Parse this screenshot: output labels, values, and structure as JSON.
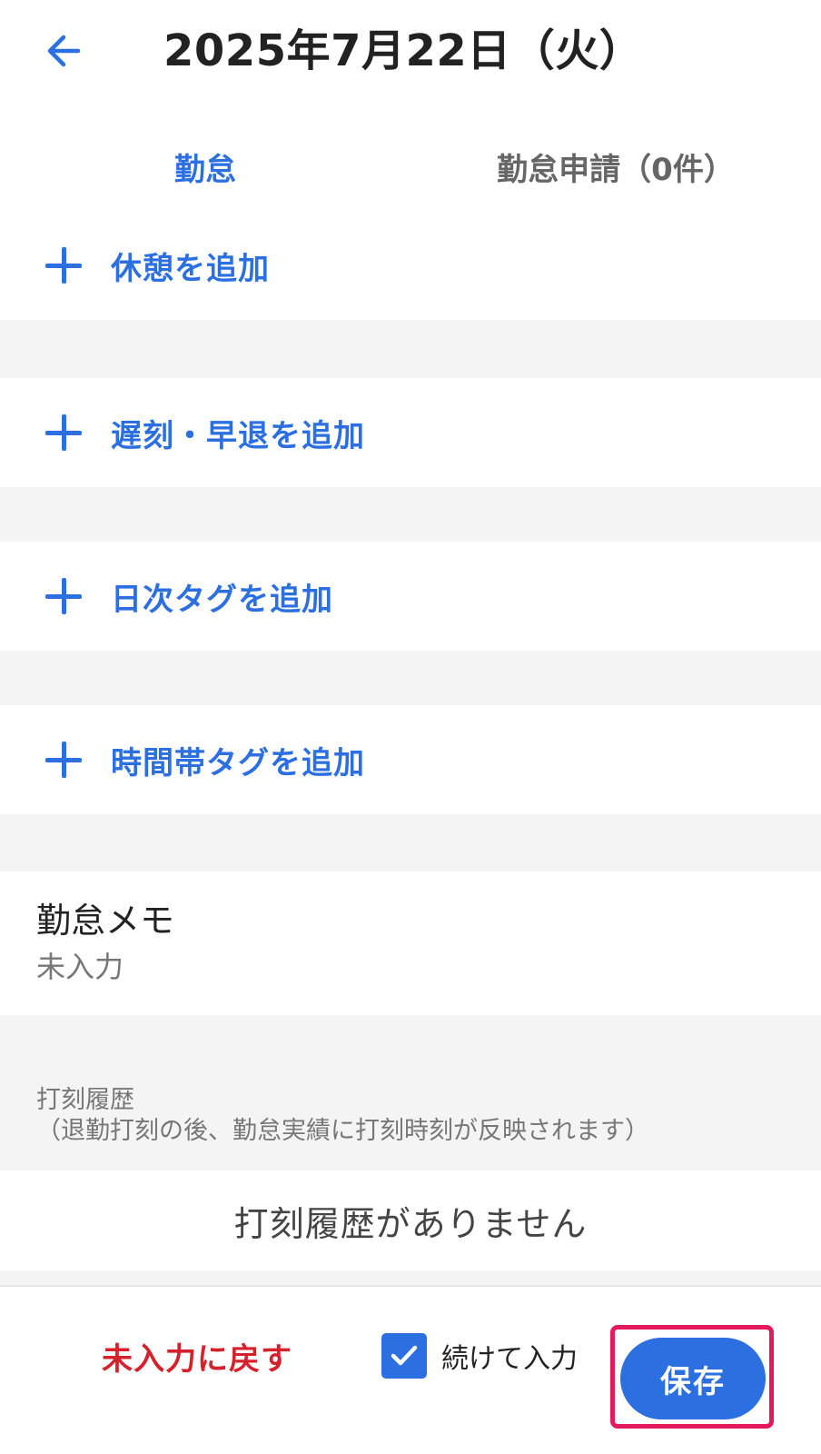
{
  "header": {
    "title": "2025年7月22日（火）",
    "back_icon": "arrow-left-icon"
  },
  "tabs": [
    {
      "label": "勤怠",
      "active": true
    },
    {
      "label": "勤怠申請（0件）",
      "active": false
    }
  ],
  "actions": {
    "add_break": "休憩を追加",
    "add_late_early": "遅刻・早退を追加",
    "add_daily_tag": "日次タグを追加",
    "add_time_tag": "時間帯タグを追加"
  },
  "memo": {
    "title": "勤怠メモ",
    "value": "未入力"
  },
  "history": {
    "title": "打刻履歴",
    "note": "（退勤打刻の後、勤怠実績に打刻時刻が反映されます）",
    "empty": "打刻履歴がありません"
  },
  "footer": {
    "reset_label": "未入力に戻す",
    "continue_label": "続けて入力",
    "continue_checked": true,
    "save_label": "保存"
  },
  "colors": {
    "accent": "#2b6fe0",
    "danger": "#d4212b",
    "highlight": "#e5195e",
    "section_bg": "#f5f4f4"
  }
}
